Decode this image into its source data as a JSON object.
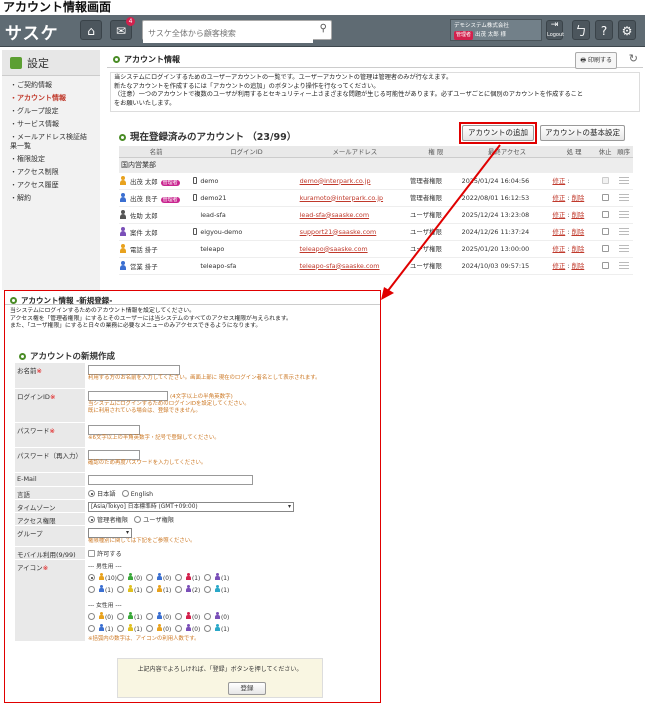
{
  "page_title": "アカウント情報画面",
  "topbar": {
    "logo": "サスケ",
    "notification_count": "4",
    "search_placeholder": "サスケ全体から顧客検索",
    "company_name": "デモシステム株式会社",
    "user_role_badge": "管理者",
    "user_name": "出茂 太郎 様",
    "logout_label": "Logout",
    "help_label": "?"
  },
  "sidebar": {
    "title": "設定",
    "items": [
      "ご契約情報",
      "アカウント情報",
      "グループ設定",
      "サービス情報",
      "メールアドレス検証結果一覧",
      "権限設定",
      "アクセス制限",
      "アクセス履歴",
      "解約"
    ]
  },
  "main": {
    "section_title": "アカウント情報",
    "print_label": "印刷する",
    "desc1": "当システムにログインするためのユーザーアカウントの一覧です。ユーザーアカウントの管理は管理者のみが行なえます。",
    "desc2": "新たなアカウントを作成するには「アカウントの追加」のボタンより操作を行なってください。",
    "desc3": "（注意）一つのアカウントで複数のユーザが利用するとセキュリティー上さまざまな問題が生じる可能性があります。必ずユーザごとに個別のアカウントを作成すること",
    "desc4": "をお願いいたします。",
    "list_header": "現在登録済みのアカウント （23/99）",
    "add_button": "アカウントの追加",
    "basic_settings_button": "アカウントの基本設定",
    "columns": [
      "名前",
      "ログインID",
      "メールアドレス",
      "権 限",
      "最終アクセス",
      "処 理",
      "休止",
      "順序"
    ],
    "group_name": "国内営業部",
    "admin_badge": "管理者",
    "edit_label": "修正",
    "delete_label": "削除",
    "rows": [
      {
        "name": "出茂 太郎",
        "login": "demo",
        "email": "demo@interpark.co.jp",
        "role": "管理者権限",
        "last": "2025/01/24 16:04:56",
        "admin": true,
        "device": true,
        "color": "#e8a21e"
      },
      {
        "name": "出茂 良子",
        "login": "demo21",
        "email": "kuramoto@interpark.co.jp",
        "role": "管理者権限",
        "last": "2022/08/01 16:12:53",
        "admin": true,
        "device": true,
        "color": "#3b6fd1"
      },
      {
        "name": "佐助 太郎",
        "login": "lead-sfa",
        "email": "lead-sfa@saaske.com",
        "role": "ユーザ権限",
        "last": "2025/12/24 13:23:08",
        "admin": false,
        "device": false,
        "color": "#555555"
      },
      {
        "name": "案件 太郎",
        "login": "eigyou-demo",
        "email": "support21@saaske.com",
        "role": "ユーザ権限",
        "last": "2024/12/26 11:37:24",
        "admin": false,
        "device": true,
        "color": "#7a4fb8"
      },
      {
        "name": "電話 掛子",
        "login": "teleapo",
        "email": "teleapo@saaske.com",
        "role": "ユーザ権限",
        "last": "2025/01/20 13:00:00",
        "admin": false,
        "device": false,
        "color": "#e8a21e"
      },
      {
        "name": "営業 掛子",
        "login": "teleapo-sfa",
        "email": "teleapo-sfa@saaske.com",
        "role": "ユーザ権限",
        "last": "2024/10/03 09:57:15",
        "admin": false,
        "device": false,
        "color": "#3b6fd1"
      }
    ]
  },
  "form": {
    "panel_title": "アカウント情報 -新規登録-",
    "desc1": "当システムにログインするためのアカウント情報を設定してください。",
    "desc2": "アクセス権を「管理者権限」にするとそのユーザーには当システムのすべてのアクセス権限が与えられます。",
    "desc3": "また、「ユーザ権限」にすると日々の業務に必要なメニューのみアクセスできるようになります。",
    "heading": "アカウントの新規作成",
    "name_label": "お名前",
    "name_hint": "利用する方のお名前を入力してください。画面上部に 現在のログイン者名として表示されます。",
    "login_label": "ログインID",
    "login_rule": "(4文字以上の半角英数字)",
    "login_hint1": "当システムにログインするためのログインIDを設定してください。",
    "login_hint2": "既に利用されている場合は、登録できません。",
    "password_label": "パスワード",
    "password_hint": "※6文字以上の半角英数字・記号で登録してください。",
    "password2_label": "パスワード（再入力）",
    "password2_hint": "確認のため再度パスワードを入力してください。",
    "email_label": "E-Mail",
    "lang_label": "言語",
    "lang_ja": "日本語",
    "lang_en": "English",
    "tz_label": "タイムゾーン",
    "tz_value": "[Asia/Tokyo] 日本標準時 (GMT+09:00)",
    "perm_label": "アクセス権限",
    "perm_admin": "管理者権限",
    "perm_user": "ユーザ権限",
    "group_label": "グループ",
    "group_hint": "権限種別に関しては下記をご参照ください。",
    "mobile_label": "モバイル利用(9/99)",
    "mobile_opt": "許可する",
    "icon_label": "アイコン",
    "male_header": "--- 男性用 ---",
    "female_header": "--- 女性用 ---",
    "male_counts": [
      "(10)",
      "(0)",
      "(0)",
      "(1)",
      "(1)",
      "(1)",
      "(1)",
      "(1)",
      "(2)",
      "(1)"
    ],
    "female_counts": [
      "(0)",
      "(1)",
      "(0)",
      "(0)",
      "(0)",
      "(1)",
      "(1)",
      "(0)",
      "(0)",
      "(1)"
    ],
    "icon_note": "※括弧内の数字は、アイコンの利用人数です。",
    "confirm_text": "上記内容でよろしければ、「登録」ボタンを押してください。",
    "register_label": "登録"
  },
  "colors": {
    "accent_red": "#e00000",
    "link_red": "#c0392b",
    "admin_badge": "#c9258f",
    "sidebar_green": "#5c9f32"
  },
  "icon_colors": [
    "#e8a21e",
    "#3aa83a",
    "#3b6fd1",
    "#d3214d",
    "#7a4fb8",
    "#3b6fd1",
    "#e0c020",
    "#e8a21e",
    "#7a4fb8",
    "#2aa8c8"
  ]
}
